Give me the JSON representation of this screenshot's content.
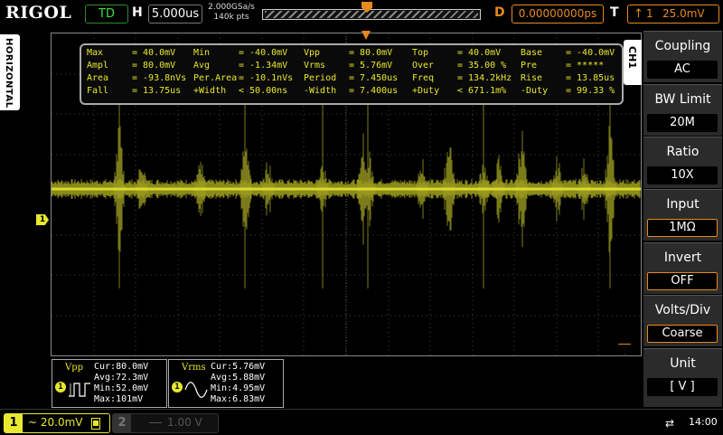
{
  "header": {
    "brand": "RIGOL",
    "run_state": "TD",
    "h_label": "H",
    "timebase": "5.000us",
    "sample_rate": "2.000GSa/s",
    "memory_depth": "140k pts",
    "d_label": "D",
    "trigger_delay": "0.00000000ps",
    "t_label": "T",
    "trigger_channel": "1",
    "trigger_level": "25.0mV",
    "trigger_edge_icon": "rising-edge-icon"
  },
  "left_tab": {
    "label": "HORIZONTAL"
  },
  "channel_marker": "1",
  "measurements": {
    "rows": [
      [
        [
          "Max",
          "= 40.0mV"
        ],
        [
          "Min",
          "= -40.0mV"
        ],
        [
          "Vpp",
          "= 80.0mV"
        ],
        [
          "Top",
          "= 40.0mV"
        ],
        [
          "Base",
          "= -40.0mV"
        ]
      ],
      [
        [
          "Ampl",
          "= 80.0mV"
        ],
        [
          "Avg",
          "= -1.34mV"
        ],
        [
          "Vrms",
          "= 5.76mV"
        ],
        [
          "Over",
          "= 35.00 %"
        ],
        [
          "Pre",
          "= *****"
        ]
      ],
      [
        [
          "Area",
          "= -93.8nVs"
        ],
        [
          "Per.Area",
          "= -10.1nVs"
        ],
        [
          "Period",
          "= 7.450us"
        ],
        [
          "Freq",
          "= 134.2kHz"
        ],
        [
          "Rise",
          "= 13.85us"
        ]
      ],
      [
        [
          "Fall",
          "= 13.75us"
        ],
        [
          "+Width",
          "< 50.00ns"
        ],
        [
          "-Width",
          "= 7.400us"
        ],
        [
          "+Duty",
          "< 671.1m%"
        ],
        [
          "-Duty",
          "= 99.33 %"
        ]
      ]
    ]
  },
  "stat_boxes": [
    {
      "title": "Vpp",
      "channel": "1",
      "cur": "Cur:80.0mV",
      "avg": "Avg:72.3mV",
      "min": "Min:52.0mV",
      "max": "Max:101mV"
    },
    {
      "title": "Vrms",
      "channel": "1",
      "cur": "Cur:5.76mV",
      "avg": "Avg:5.88mV",
      "min": "Min:4.95mV",
      "max": "Max:6.83mV"
    }
  ],
  "menu": {
    "channel_tab": "CH1",
    "items": [
      {
        "title": "Coupling",
        "value": "AC"
      },
      {
        "title": "BW Limit",
        "value": "20M"
      },
      {
        "title": "Ratio",
        "value": "10X"
      },
      {
        "title": "Input",
        "value": "1MΩ"
      },
      {
        "title": "Invert",
        "value": "OFF"
      },
      {
        "title": "Volts/Div",
        "value": "Coarse"
      },
      {
        "title": "Unit",
        "value": "[ V ]"
      }
    ]
  },
  "status": {
    "ch1_num": "1",
    "ch1_scale": "~ 20.0mV",
    "ch2_num": "2",
    "ch2_scale": "1.00 V",
    "usb_icon": "usb-icon",
    "time": "14:00"
  },
  "colors": {
    "ch1": "#e8e830",
    "trigger": "#e68a1e",
    "run": "#3ee03e"
  }
}
